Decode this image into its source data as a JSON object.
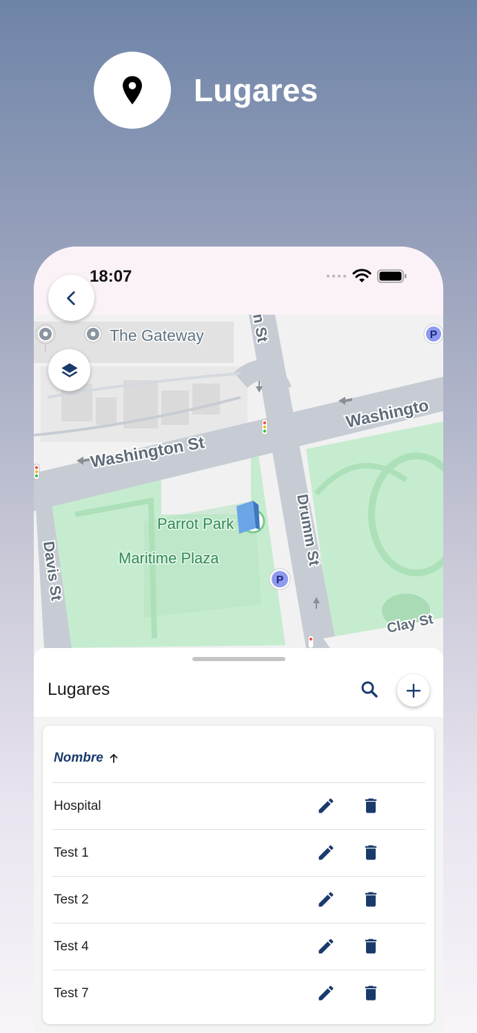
{
  "header": {
    "title": "Lugares",
    "icon": "location-pin-icon"
  },
  "status_bar": {
    "time": "18:07"
  },
  "map": {
    "labels": {
      "gateway": "The Gateway",
      "washington_left": "Washington St",
      "washington_right": "Washingto",
      "parrot_park": "Parrot Park",
      "maritime_plaza": "Maritime Plaza",
      "davis": "Davis St",
      "drumm": "Drumm St",
      "clay": "Clay St",
      "street_top": "n St",
      "parking": "P"
    }
  },
  "sheet": {
    "title": "Lugares",
    "table": {
      "column": "Nombre",
      "sort": "ascending",
      "rows": [
        {
          "name": "Hospital"
        },
        {
          "name": "Test 1"
        },
        {
          "name": "Test 2"
        },
        {
          "name": "Test 4"
        },
        {
          "name": "Test 7"
        }
      ]
    }
  },
  "colors": {
    "accent": "#1a3a6b",
    "park": "#c6ecd0",
    "road": "#c7ccd4"
  }
}
